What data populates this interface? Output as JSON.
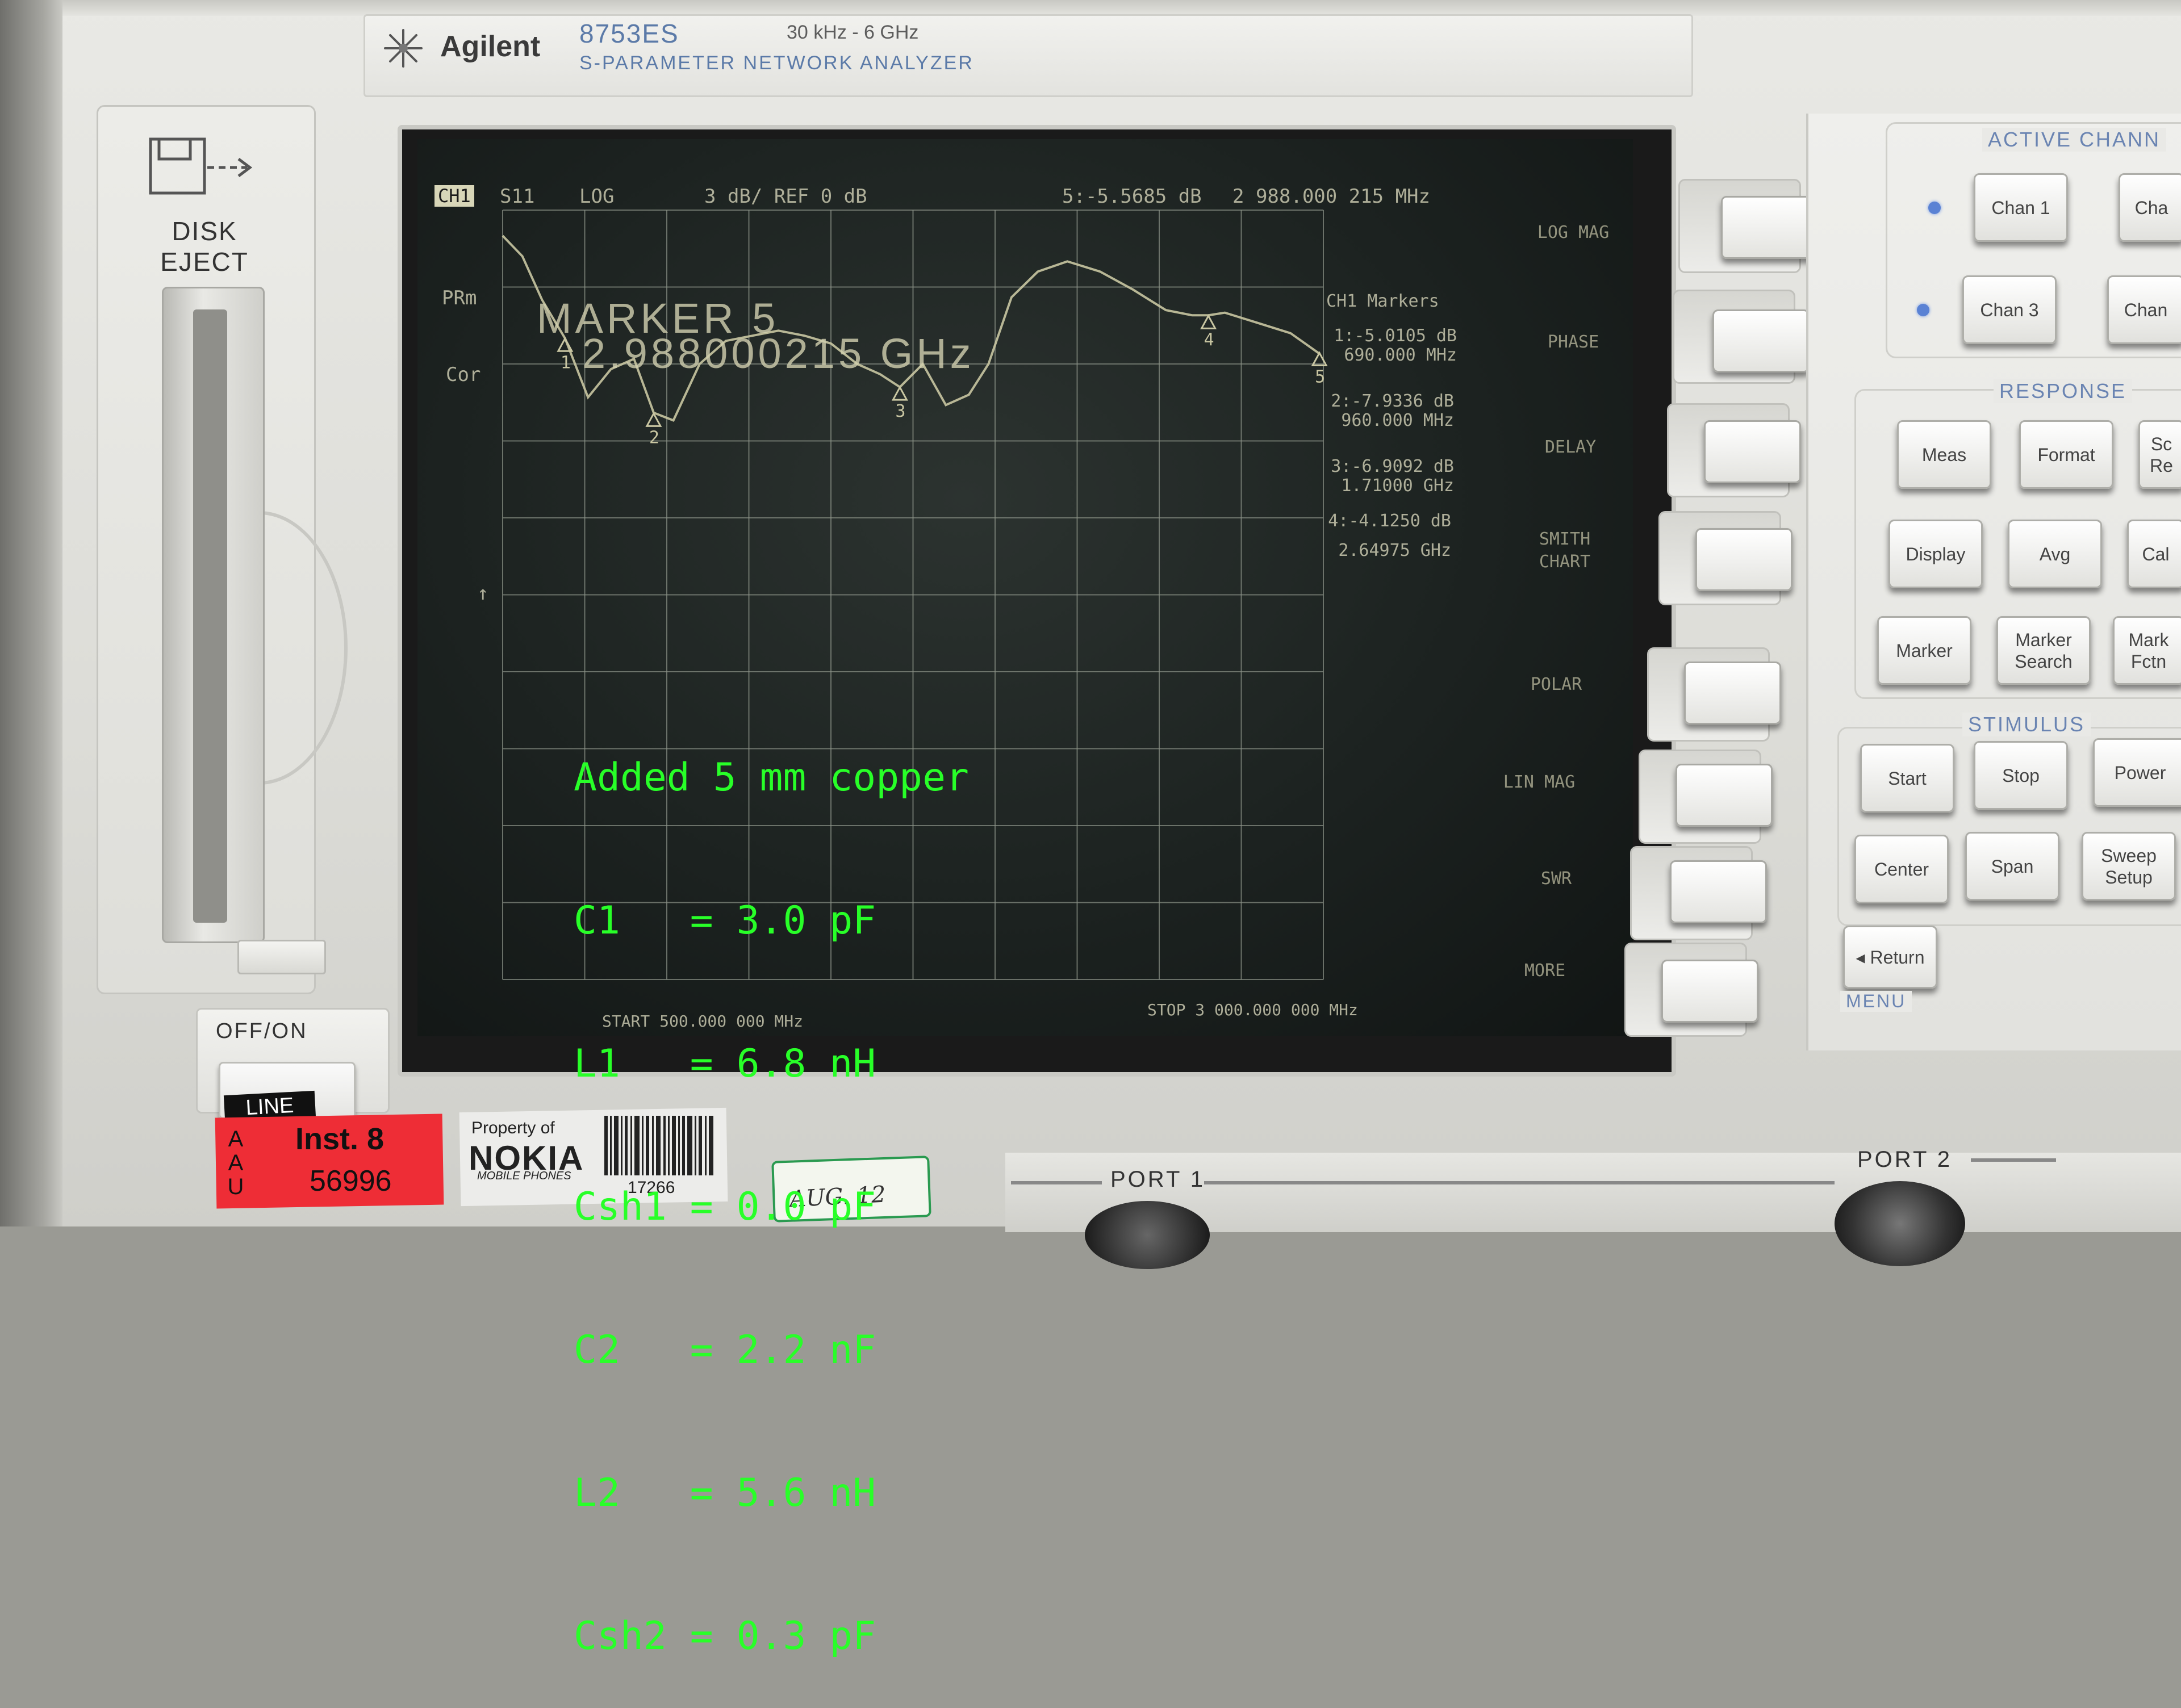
{
  "header": {
    "brand": "Agilent",
    "model": "8753ES",
    "freq_range": "30 kHz - 6 GHz",
    "description": "S-PARAMETER NETWORK ANALYZER"
  },
  "disk": {
    "label_line1": "DISK",
    "label_line2": "EJECT"
  },
  "power": {
    "label": "OFF/ON",
    "line": "LINE"
  },
  "screen": {
    "channel": "CH1",
    "param": "S11",
    "format": "LOG",
    "scale": "3 dB/ REF 0 dB",
    "marker_readout": "5:-5.5685 dB",
    "marker_freq": "2 988.000 215 MHz",
    "prm": "PRm",
    "cor": "Cor",
    "marker_title": "MARKER 5",
    "marker_value": "2.988000215 GHz",
    "markers_header": "CH1 Markers",
    "markers": [
      {
        "db": "1:-5.0105 dB",
        "freq": "690.000 MHz"
      },
      {
        "db": "2:-7.9336 dB",
        "freq": "960.000 MHz"
      },
      {
        "db": "3:-6.9092 dB",
        "freq": "1.71000 GHz"
      },
      {
        "db": "4:-4.1250 dB",
        "freq": "2.64975 GHz"
      }
    ],
    "start": "START 500.000 000 MHz",
    "stop": "STOP 3 000.000 000 MHz",
    "softkeys": [
      "LOG MAG",
      "PHASE",
      "DELAY",
      "SMITH",
      "CHART",
      "POLAR",
      "LIN MAG",
      "SWR",
      "MORE"
    ],
    "notes": [
      "Added 5 mm copper",
      "C1   = 3.0 pF",
      "L1   = 6.8 nH",
      "Csh1 = 0.0 pF",
      "C2   = 2.2 nF",
      "L2   = 5.6 nH",
      "Csh2 = 0.3 pF"
    ]
  },
  "chart_data": {
    "type": "line",
    "title": "",
    "xlabel": "",
    "ylabel": "",
    "x_unit": "MHz",
    "xlim": [
      500,
      3000
    ],
    "ylim": [
      -30,
      0
    ],
    "grid": true,
    "series": [
      {
        "name": "S11",
        "x": [
          500,
          560,
          620,
          690,
          760,
          830,
          900,
          960,
          1020,
          1100,
          1180,
          1260,
          1340,
          1420,
          1500,
          1580,
          1650,
          1710,
          1780,
          1850,
          1920,
          1980,
          2050,
          2130,
          2220,
          2320,
          2420,
          2520,
          2600,
          2650,
          2700,
          2800,
          2900,
          2988
        ],
        "y": [
          -1.0,
          -1.8,
          -3.5,
          -5.0,
          -7.3,
          -6.2,
          -5.8,
          -7.9,
          -8.2,
          -6.0,
          -5.1,
          -4.9,
          -4.7,
          -4.9,
          -5.2,
          -6.0,
          -6.4,
          -6.9,
          -6.0,
          -7.6,
          -7.2,
          -6.0,
          -3.4,
          -2.4,
          -2.0,
          -2.4,
          -3.1,
          -3.9,
          -4.1,
          -4.1,
          -4.0,
          -4.4,
          -4.8,
          -5.6
        ]
      }
    ],
    "markers": [
      {
        "id": "1",
        "x": 690,
        "y": -5.0105
      },
      {
        "id": "2",
        "x": 960,
        "y": -7.9336
      },
      {
        "id": "3",
        "x": 1710,
        "y": -6.9092
      },
      {
        "id": "4",
        "x": 2649.75,
        "y": -4.125
      },
      {
        "id": "5",
        "x": 2988.000215,
        "y": -5.5685
      }
    ]
  },
  "panel": {
    "active_channel": {
      "title": "ACTIVE CHANN",
      "keys": [
        "Chan 1",
        "Cha",
        "Chan 3",
        "Chan"
      ]
    },
    "response": {
      "title": "RESPONSE",
      "keys": [
        [
          "Meas",
          "Format",
          "Sc Re"
        ],
        [
          "Display",
          "Avg",
          "Cal"
        ],
        [
          "Marker",
          "Marker Search",
          "Mark Fctn"
        ]
      ]
    },
    "stimulus": {
      "title": "STIMULUS",
      "keys": [
        [
          "Start",
          "Stop",
          "Power"
        ],
        [
          "Center",
          "Span",
          "Sweep Setup"
        ]
      ]
    },
    "menu": {
      "return": "◂ Return",
      "label": "MENU"
    }
  },
  "stickers": {
    "aau": [
      "A",
      "A",
      "U"
    ],
    "inst": "Inst. 8",
    "inst_num": "56996",
    "property_of": "Property of",
    "nokia": "NOKIA",
    "nokia_sub": "MOBILE PHONES",
    "barcode_num": "17266",
    "cal_date": "AUG. 12"
  },
  "ports": {
    "port1": "PORT 1",
    "port2": "PORT 2"
  },
  "colors": {
    "trace": "#c9c6a2",
    "grid": "#8c9388",
    "note_green": "#28ff28",
    "led": "#5a82d4",
    "panel_title": "#6a84b2"
  }
}
